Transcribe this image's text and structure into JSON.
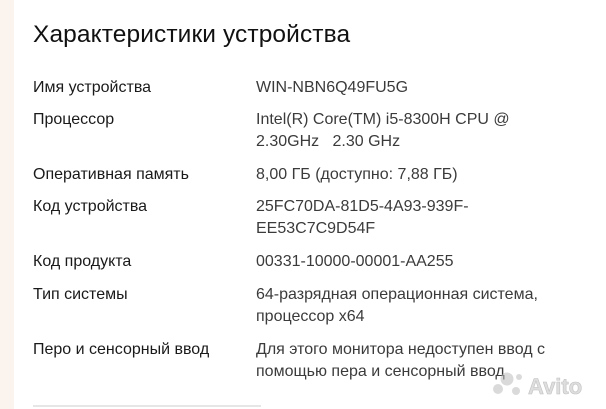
{
  "section": {
    "title": "Характеристики устройства"
  },
  "specs": [
    {
      "label": "Имя устройства",
      "value": [
        "WIN-NBN6Q49FU5G"
      ]
    },
    {
      "label": "Процессор",
      "value": [
        "Intel(R) Core(TM) i5-8300H CPU @",
        "2.30GHz   2.30 GHz"
      ]
    },
    {
      "label": "Оперативная память",
      "value": [
        "8,00 ГБ (доступно: 7,88 ГБ)"
      ]
    },
    {
      "label": "Код устройства",
      "value": [
        "25FC70DA-81D5-4A93-939F-",
        "EE53C7C9D54F"
      ]
    },
    {
      "label": "Код продукта",
      "value": [
        "00331-10000-00001-AA255"
      ]
    },
    {
      "label": "Тип системы",
      "value": [
        "64-разрядная операционная система,",
        "процессор x64"
      ]
    },
    {
      "label": "Перо и сенсорный ввод",
      "value": [
        "Для этого монитора недоступен ввод с",
        "помощью пера и сенсорный ввод"
      ]
    }
  ],
  "watermark": {
    "text": "Avito"
  }
}
